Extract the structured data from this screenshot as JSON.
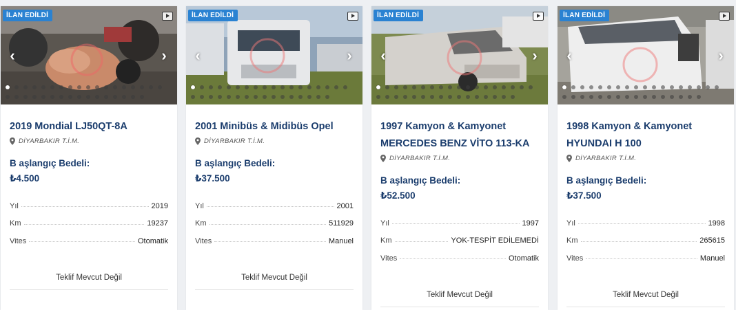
{
  "cards": [
    {
      "badge": "İLAN EDİLDİ",
      "title": "2019 Mondial LJ50QT-8A",
      "location": "DİYARBAKIR T.İ.M.",
      "price_label": "B aşlangıç Bedeli:",
      "price": "₺4.500",
      "specs": [
        {
          "key": "Yıl",
          "value": "2019"
        },
        {
          "key": "Km",
          "value": "19237"
        },
        {
          "key": "Vites",
          "value": "Otomatik"
        }
      ],
      "offer": "Teklif Mevcut Değil"
    },
    {
      "badge": "İLAN EDİLDİ",
      "title": "2001 Minibüs & Midibüs Opel",
      "location": "DİYARBAKIR T.İ.M.",
      "price_label": "B aşlangıç Bedeli:",
      "price": "₺37.500",
      "specs": [
        {
          "key": "Yıl",
          "value": "2001"
        },
        {
          "key": "Km",
          "value": "511929"
        },
        {
          "key": "Vites",
          "value": "Manuel"
        }
      ],
      "offer": "Teklif Mevcut Değil"
    },
    {
      "badge": "İLAN EDİLDİ",
      "title": "1997 Kamyon & Kamyonet MERCEDES BENZ VİTO 113-KA",
      "location": "DİYARBAKIR T.İ.M.",
      "price_label": "B aşlangıç Bedeli:",
      "price": "₺52.500",
      "specs": [
        {
          "key": "Yıl",
          "value": "1997"
        },
        {
          "key": "Km",
          "value": "YOK-TESPİT EDİLEMEDİ"
        },
        {
          "key": "Vites",
          "value": "Otomatik"
        }
      ],
      "offer": "Teklif Mevcut Değil"
    },
    {
      "badge": "İLAN EDİLDİ",
      "title": "1998 Kamyon & Kamyonet HYUNDAI H 100",
      "location": "DİYARBAKIR T.İ.M.",
      "price_label": "B aşlangıç Bedeli:",
      "price": "₺37.500",
      "specs": [
        {
          "key": "Yıl",
          "value": "1998"
        },
        {
          "key": "Km",
          "value": "265615"
        },
        {
          "key": "Vites",
          "value": "Manuel"
        }
      ],
      "offer": "Teklif Mevcut Değil"
    }
  ],
  "icons": {
    "video": "video-play-icon",
    "prev": "chevron-left-icon",
    "next": "chevron-right-icon",
    "location": "map-pin-icon"
  },
  "colors": {
    "badge": "#2a82d2",
    "title": "#1b3d6d"
  }
}
